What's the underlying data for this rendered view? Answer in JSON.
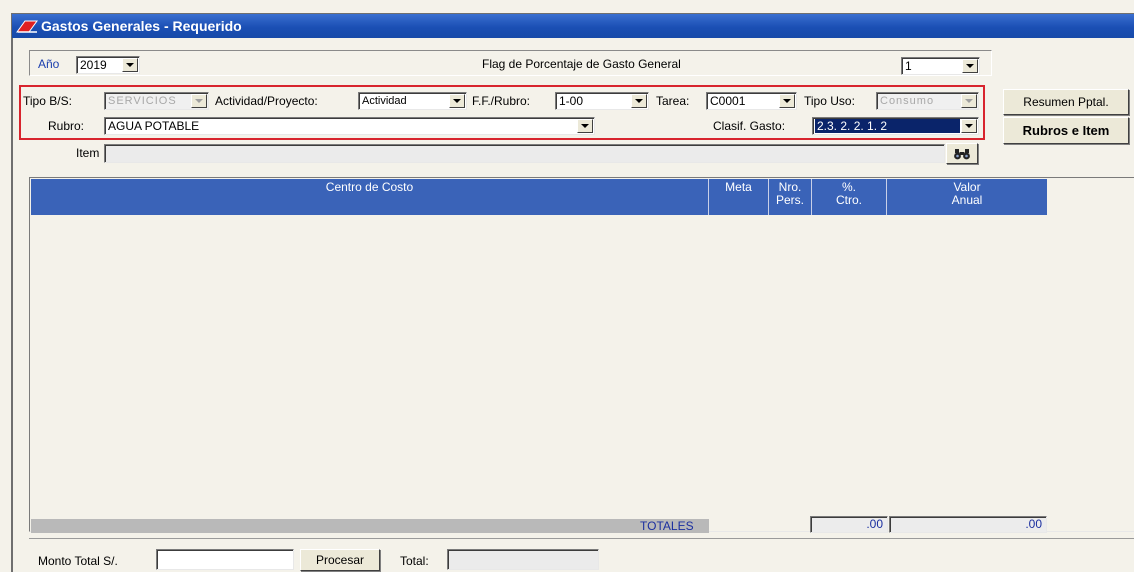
{
  "window": {
    "title": "Gastos Generales - Requerido",
    "accent": "#1b4fb4",
    "highlight_border": "#d8242e"
  },
  "filters": {
    "anio_label": "Año",
    "anio_value": "2019",
    "flag_label": "Flag de Porcentaje de Gasto General",
    "flag_value": "1"
  },
  "form": {
    "tipo_bs_label": "Tipo B/S:",
    "tipo_bs_value": "SERVICIOS",
    "actividad_label": "Actividad/Proyecto:",
    "actividad_value": "Actividad",
    "ff_rubro_label": "F.F./Rubro:",
    "ff_rubro_value": "1-00",
    "tarea_label": "Tarea:",
    "tarea_value": "C0001",
    "tipo_uso_label": "Tipo Uso:",
    "tipo_uso_value": "Consumo",
    "rubro_label": "Rubro:",
    "rubro_value": "AGUA POTABLE",
    "clasif_label": "Clasif. Gasto:",
    "clasif_value": "2.3. 2. 2. 1. 2",
    "item_label": "Item",
    "item_value": ""
  },
  "side_buttons": {
    "resumen_label": "Resumen Pptal.",
    "rubros_label": "Rubros e Item"
  },
  "grid": {
    "columns": [
      {
        "label": "Centro de Costo"
      },
      {
        "label": "Meta"
      },
      {
        "line1": "Nro.",
        "line2": "Pers."
      },
      {
        "line1": "%.",
        "line2": "Ctro."
      },
      {
        "line1": "Valor",
        "line2": "Anual"
      }
    ],
    "totals_label": "TOTALES",
    "total_pct": ".00",
    "total_valor": ".00"
  },
  "footer": {
    "monto_label": "Monto Total S/.",
    "monto_value": "",
    "procesar_label": "Procesar",
    "total_label": "Total:",
    "total_value": ""
  }
}
